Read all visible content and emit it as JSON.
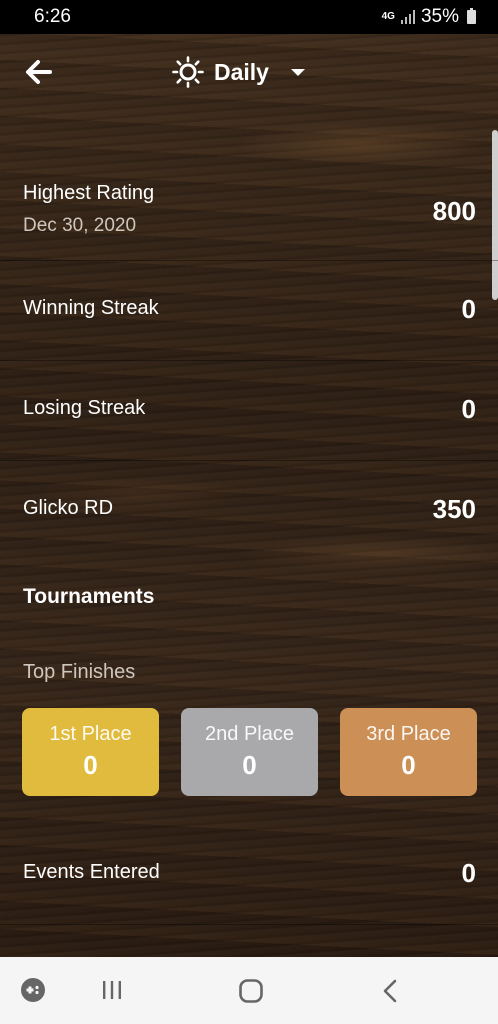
{
  "status_bar": {
    "time": "6:26",
    "network": "4G",
    "battery": "35%"
  },
  "header": {
    "title": "Daily",
    "back_icon": "arrow-left-icon",
    "mode_icon": "sun-icon"
  },
  "stats": [
    {
      "label": "Highest Rating",
      "sub": "Dec 30, 2020",
      "value": "800"
    },
    {
      "label": "Winning Streak",
      "value": "0"
    },
    {
      "label": "Losing Streak",
      "value": "0"
    },
    {
      "label": "Glicko RD",
      "value": "350"
    }
  ],
  "tournaments": {
    "title": "Tournaments",
    "top_finishes_label": "Top Finishes",
    "places": [
      {
        "label": "1st Place",
        "value": "0",
        "color": "#e1bb3d"
      },
      {
        "label": "2nd Place",
        "value": "0",
        "color": "#a9a9ac"
      },
      {
        "label": "3rd Place",
        "value": "0",
        "color": "#cc8f55"
      }
    ],
    "events_entered_label": "Events Entered",
    "events_entered_value": "0"
  },
  "nav_bar": {
    "icons": [
      "game-launcher-icon",
      "recent-apps-icon",
      "home-icon",
      "back-icon"
    ]
  }
}
